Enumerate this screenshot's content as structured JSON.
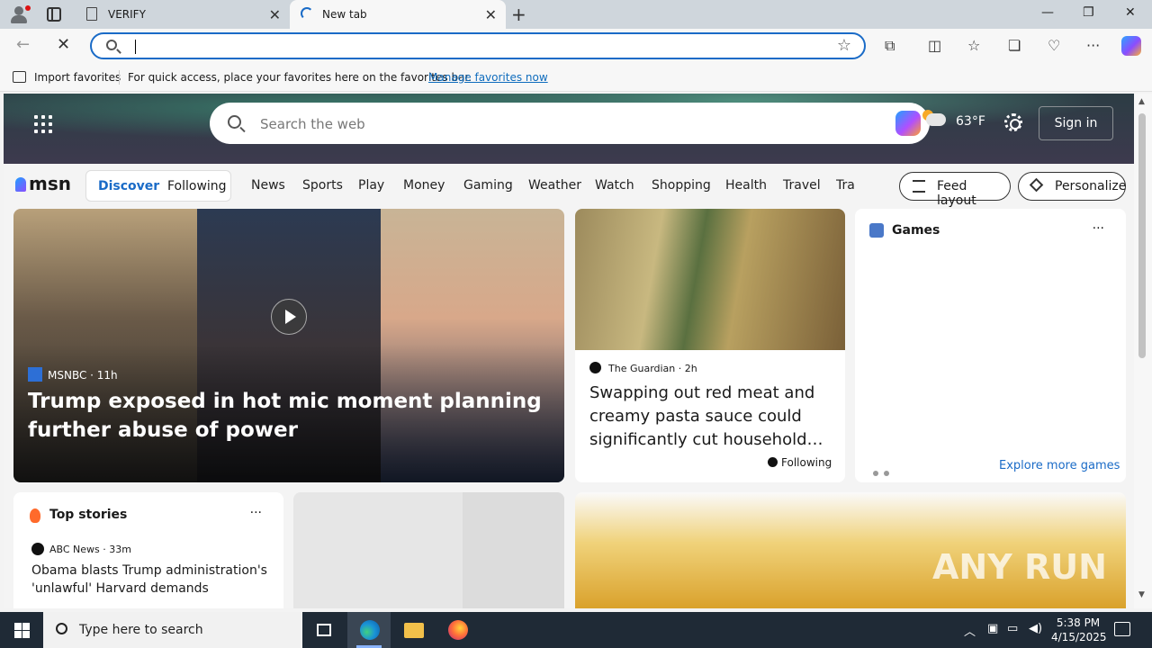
{
  "browser": {
    "tabs": [
      {
        "title": "VERIFY",
        "close": "✕"
      },
      {
        "title": "New tab",
        "close": "✕"
      }
    ],
    "new_tab": "+",
    "window": {
      "minimize": "—",
      "restore": "❐",
      "close": "✕"
    },
    "address": {
      "value": "",
      "placeholder": ""
    },
    "favorites_bar": {
      "import": "Import favorites",
      "message": "For quick access, place your favorites here on the favorites bar.",
      "manage_link": "Manage favorites now"
    }
  },
  "msn": {
    "search_placeholder": "Search the web",
    "weather": "63°F",
    "sign_in": "Sign in",
    "logo": "msn",
    "feed_tabs": {
      "discover": "Discover",
      "following": "Following"
    },
    "nav": [
      "News",
      "Sports",
      "Play",
      "Money",
      "Gaming",
      "Weather",
      "Watch",
      "Shopping",
      "Health",
      "Travel",
      "Tra"
    ],
    "feed_layout": "Feed layout",
    "personalize": "Personalize",
    "hero": {
      "source": "MSNBC · 11h",
      "headline": "Trump exposed in hot mic moment planning further abuse of power"
    },
    "card2": {
      "source": "The Guardian · 2h",
      "headline": "Swapping out red meat and creamy pasta sauce could significantly cut household…",
      "following": "Following"
    },
    "games": {
      "title": "Games",
      "more": "···",
      "explore": "Explore more games"
    },
    "top_stories": {
      "title": "Top stories",
      "more": "···",
      "source": "ABC News · 33m",
      "headline": "Obama blasts Trump administration's 'unlawful' Harvard demands"
    },
    "watermark": "ANY RUN"
  },
  "taskbar": {
    "search_placeholder": "Type here to search",
    "time": "5:38 PM",
    "date": "4/15/2025"
  }
}
